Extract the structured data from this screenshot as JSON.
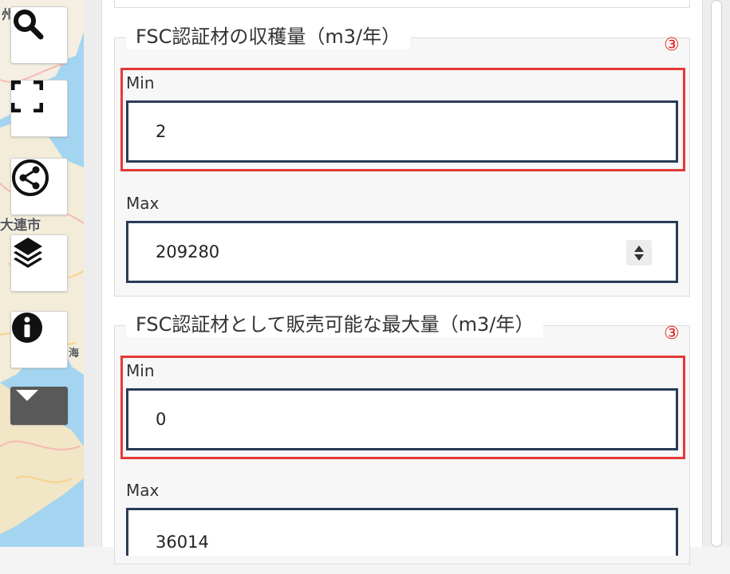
{
  "map": {
    "labels": [
      "大連市",
      "州",
      "海"
    ]
  },
  "toolbar": {
    "buttons": [
      {
        "name": "search-icon"
      },
      {
        "name": "fullscreen-icon"
      },
      {
        "name": "share-icon"
      },
      {
        "name": "layers-icon"
      },
      {
        "name": "info-icon"
      },
      {
        "name": "chevron-down-icon"
      }
    ]
  },
  "filters": [
    {
      "legend": "FSC認証材の収穫量（m3/年）",
      "marker": "③",
      "min": {
        "label": "Min",
        "value": "2"
      },
      "max": {
        "label": "Max",
        "value": "209280"
      }
    },
    {
      "legend": "FSC認証材として販売可能な最大量（m3/年）",
      "marker": "③",
      "min": {
        "label": "Min",
        "value": "0"
      },
      "max": {
        "label": "Max",
        "value": "36014"
      }
    }
  ],
  "colors": {
    "highlight": "#e53935",
    "input_border": "#2b3a55",
    "marker": "#e02020"
  }
}
